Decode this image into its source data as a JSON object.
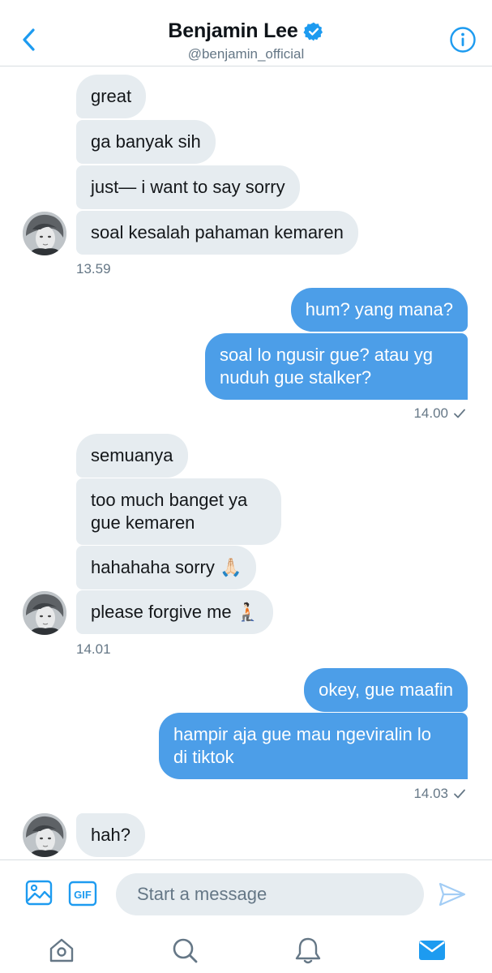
{
  "header": {
    "name": "Benjamin Lee",
    "handle": "@benjamin_official",
    "verified": true,
    "accent_color": "#1d9bf0"
  },
  "messages": {
    "group1": {
      "items": [
        "great",
        "ga banyak sih",
        "just— i want to say sorry",
        "soal kesalah pahaman kemaren"
      ],
      "time": "13.59"
    },
    "group2": {
      "items": [
        "hum? yang mana?",
        "soal lo ngusir gue? atau yg",
        "nuduh gue stalker?"
      ],
      "time": "14.00"
    },
    "group3": {
      "items": [
        "semuanya",
        "too much banget ya",
        "gue kemaren",
        "hahahaha sorry 🙏🏻",
        "please forgive me 🧎🏻"
      ],
      "time": "14.01"
    },
    "group4": {
      "items": [
        "okey, gue maafin",
        "hampir aja gue mau ngeviralin lo",
        "di tiktok"
      ],
      "time": "14.03"
    },
    "group5": {
      "items": [
        "hah?"
      ]
    }
  },
  "composer": {
    "placeholder": "Start a message",
    "gif_label": "GIF"
  },
  "colors": {
    "incoming_bubble": "#e6ecf0",
    "outgoing_bubble": "#4c9ee8",
    "accent": "#1d9bf0",
    "icon_gray": "#657786"
  },
  "tabs": [
    "home-icon",
    "search-icon",
    "notifications-icon",
    "messages-icon"
  ],
  "active_tab": "messages-icon"
}
